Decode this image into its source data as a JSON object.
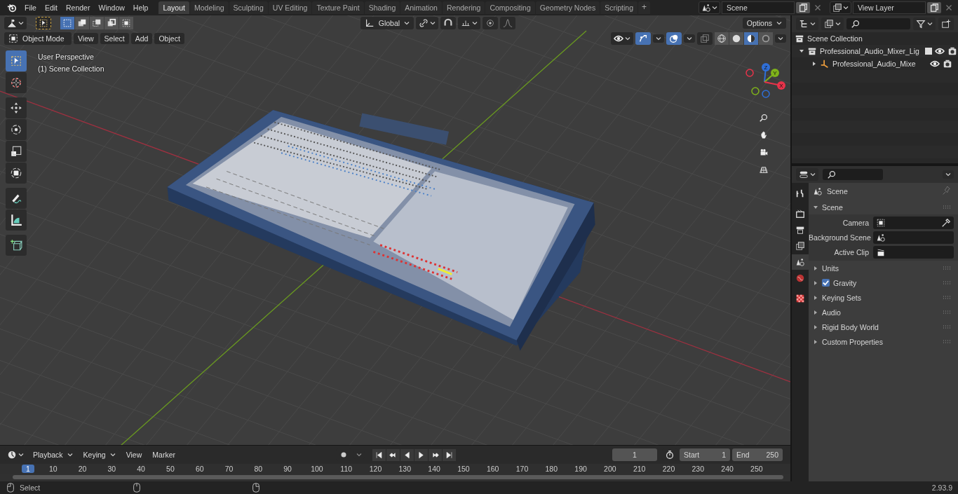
{
  "top_bar": {
    "menus": [
      "File",
      "Edit",
      "Render",
      "Window",
      "Help"
    ],
    "workspaces": [
      {
        "label": "Layout",
        "selected": true
      },
      {
        "label": "Modeling",
        "selected": false
      },
      {
        "label": "Sculpting",
        "selected": false
      },
      {
        "label": "UV Editing",
        "selected": false
      },
      {
        "label": "Texture Paint",
        "selected": false
      },
      {
        "label": "Shading",
        "selected": false
      },
      {
        "label": "Animation",
        "selected": false
      },
      {
        "label": "Rendering",
        "selected": false
      },
      {
        "label": "Compositing",
        "selected": false
      },
      {
        "label": "Geometry Nodes",
        "selected": false
      },
      {
        "label": "Scripting",
        "selected": false
      }
    ],
    "add_workspace": "+",
    "scene": "Scene",
    "view_layer": "View Layer"
  },
  "tool_header": {
    "select_modes": [
      {
        "kind": "set",
        "selected": true
      },
      {
        "kind": "extend",
        "selected": false
      },
      {
        "kind": "subtract",
        "selected": false
      },
      {
        "kind": "invert",
        "selected": false
      },
      {
        "kind": "intersect",
        "selected": false
      }
    ],
    "orientation": "Global",
    "snap": {
      "on": false
    },
    "proportional_editing": {
      "on": false
    },
    "options": "Options"
  },
  "viewport_header": {
    "mode": "Object Mode",
    "menus": [
      "View",
      "Select",
      "Add",
      "Object"
    ],
    "gizmos": {
      "on": true
    },
    "overlays": {
      "on": true
    },
    "xray": {
      "on": false
    },
    "shading_modes": [
      {
        "kind": "wireframe",
        "selected": false
      },
      {
        "kind": "solid",
        "selected": false
      },
      {
        "kind": "material",
        "selected": true
      },
      {
        "kind": "rendered",
        "selected": false
      }
    ]
  },
  "viewport": {
    "view_name": "User Perspective",
    "collection": "(1) Scene Collection",
    "tools": [
      {
        "kind": "select",
        "selected": true
      },
      {
        "kind": "cursor",
        "selected": false
      },
      {
        "kind": "move",
        "selected": false
      },
      {
        "kind": "rotate",
        "selected": false
      },
      {
        "kind": "scale",
        "selected": false
      },
      {
        "kind": "transform",
        "selected": false
      },
      {
        "kind": "annotate",
        "selected": false
      },
      {
        "kind": "measure",
        "selected": false
      },
      {
        "kind": "add_cube",
        "selected": false
      }
    ],
    "axes": [
      {
        "label": "Z",
        "color": "#2f6fd8"
      },
      {
        "label": "Y",
        "color": "#7fb31a"
      },
      {
        "label": "X",
        "color": "#e8334a"
      }
    ],
    "nav_buttons": [
      {
        "kind": "zoom"
      },
      {
        "kind": "pan"
      },
      {
        "kind": "camera"
      },
      {
        "kind": "ortho"
      }
    ]
  },
  "outliner": {
    "items": [
      {
        "label": "Scene Collection",
        "kind": "scene_collection",
        "children": [
          {
            "label": "Professional_Audio_Mixer_Lig",
            "kind": "collection",
            "expanded": true,
            "checked": true,
            "children": [
              {
                "label": "Professional_Audio_Mixe",
                "kind": "empty",
                "expanded": false
              }
            ]
          }
        ]
      }
    ]
  },
  "properties": {
    "tabs": [
      {
        "kind": "tool",
        "selected": false
      },
      {
        "kind": "render",
        "selected": false
      },
      {
        "kind": "output",
        "selected": false
      },
      {
        "kind": "view_layer",
        "selected": false
      },
      {
        "kind": "scene",
        "selected": true
      },
      {
        "kind": "world",
        "selected": false
      },
      {
        "kind": "texture",
        "selected": false
      }
    ],
    "context": "Scene",
    "panels": [
      {
        "label": "Scene",
        "expanded": true,
        "fields": [
          {
            "label": "Camera",
            "kind": "camera"
          },
          {
            "label": "Background Scene",
            "kind": "scene"
          },
          {
            "label": "Active Clip",
            "kind": "clip"
          }
        ]
      },
      {
        "label": "Units",
        "expanded": false
      },
      {
        "label": "Gravity",
        "expanded": false,
        "checked": true
      },
      {
        "label": "Keying Sets",
        "expanded": false
      },
      {
        "label": "Audio",
        "expanded": false
      },
      {
        "label": "Rigid Body World",
        "expanded": false
      },
      {
        "label": "Custom Properties",
        "expanded": false
      }
    ]
  },
  "timeline": {
    "menus": [
      {
        "label": "Playback",
        "kind": "dropdown"
      },
      {
        "label": "Keying",
        "kind": "dropdown"
      },
      {
        "label": "View",
        "kind": "menu"
      },
      {
        "label": "Marker",
        "kind": "menu"
      }
    ],
    "auto_keying": {
      "on": false
    },
    "current_frame": "1",
    "start_label": "Start",
    "start": "1",
    "end_label": "End",
    "end": "250",
    "playhead": "1",
    "ruler": [
      "10",
      "20",
      "30",
      "40",
      "50",
      "60",
      "70",
      "80",
      "90",
      "100",
      "110",
      "120",
      "130",
      "140",
      "150",
      "160",
      "170",
      "180",
      "190",
      "200",
      "210",
      "220",
      "230",
      "240",
      "250"
    ]
  },
  "status_bar": {
    "hint": "Select",
    "version": "2.93.9"
  }
}
